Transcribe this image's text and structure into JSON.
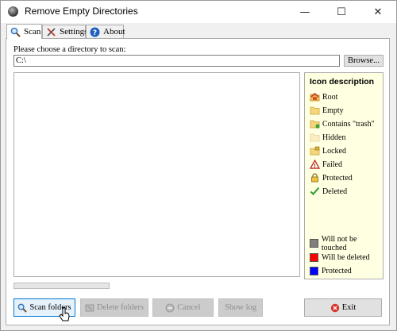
{
  "window": {
    "title": "Remove Empty Directories"
  },
  "controls": {
    "minimize": "—",
    "maximize": "☐",
    "close": "✕"
  },
  "tabs": [
    {
      "label": "Scan",
      "icon": "magnifier-icon",
      "active": true
    },
    {
      "label": "Settings",
      "icon": "tools-icon",
      "active": false
    },
    {
      "label": "About",
      "icon": "help-icon",
      "active": false
    }
  ],
  "scan": {
    "dir_label": "Please choose a directory to scan:",
    "dir_value": "C:\\",
    "browse_label": "Browse..."
  },
  "legend": {
    "title": "Icon description",
    "items": [
      {
        "label": "Root",
        "icon": "root-folder-icon"
      },
      {
        "label": "Empty",
        "icon": "empty-folder-icon"
      },
      {
        "label": "Contains \"trash\"",
        "icon": "trash-folder-icon"
      },
      {
        "label": "Hidden",
        "icon": "hidden-folder-icon"
      },
      {
        "label": "Locked",
        "icon": "locked-folder-icon"
      },
      {
        "label": "Failed",
        "icon": "warning-icon"
      },
      {
        "label": "Protected",
        "icon": "protected-lock-icon"
      },
      {
        "label": "Deleted",
        "icon": "checkmark-icon"
      }
    ],
    "swatches": [
      {
        "label": "Will not be touched",
        "color": "#808080"
      },
      {
        "label": "Will be deleted",
        "color": "#ff0000"
      },
      {
        "label": "Protected",
        "color": "#0000ff"
      }
    ]
  },
  "buttons": {
    "scan": "Scan folders",
    "delete": "Delete folders",
    "cancel": "Cancel",
    "log": "Show log",
    "exit": "Exit"
  }
}
